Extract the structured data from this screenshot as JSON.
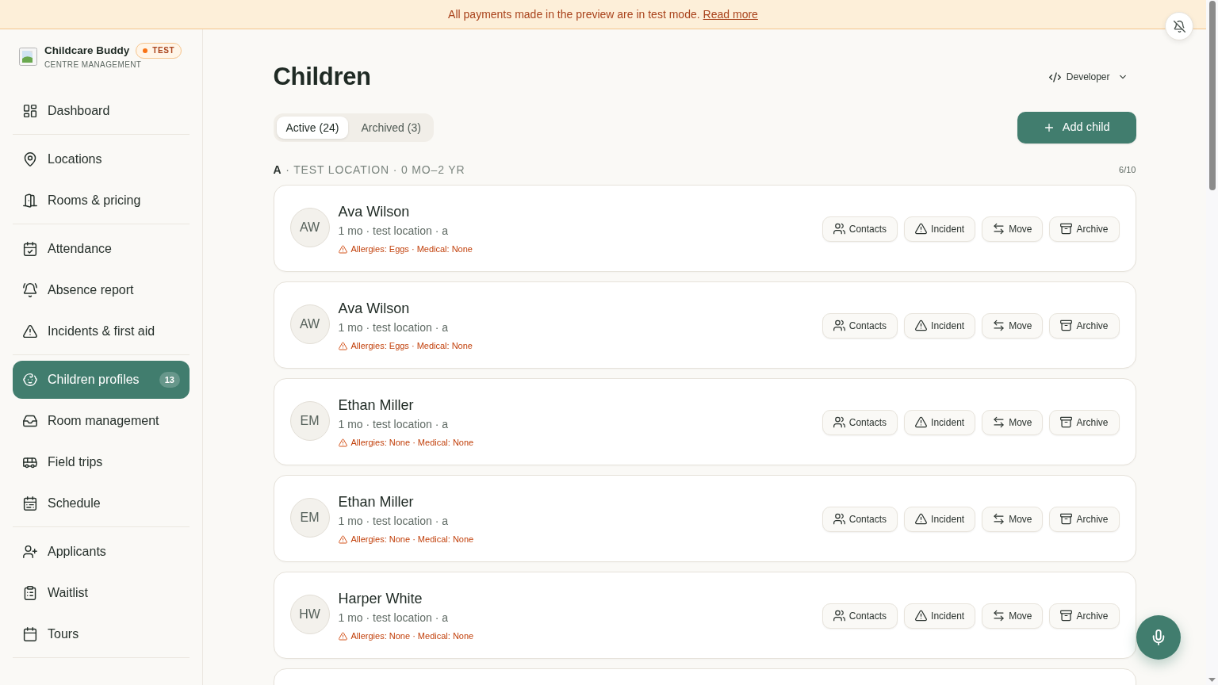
{
  "banner": {
    "message": "All payments made in the preview are in test mode.",
    "link": "Read more"
  },
  "sidebar": {
    "brand": {
      "name": "Childcare Buddy",
      "badge": "TEST",
      "subtitle": "CENTRE MANAGEMENT"
    },
    "groups": [
      {
        "items": [
          {
            "kind": "dashboard",
            "label": "Dashboard",
            "selected": false
          }
        ]
      },
      {
        "items": [
          {
            "kind": "locations",
            "label": "Locations",
            "selected": false
          },
          {
            "kind": "rooms",
            "label": "Rooms & pricing",
            "selected": false
          }
        ]
      },
      {
        "items": [
          {
            "kind": "attendance",
            "label": "Attendance",
            "selected": false
          },
          {
            "kind": "absence",
            "label": "Absence report",
            "selected": false
          },
          {
            "kind": "incidents",
            "label": "Incidents & first aid",
            "selected": false
          }
        ]
      },
      {
        "items": [
          {
            "kind": "children",
            "label": "Children profiles",
            "selected": true,
            "badge": "13"
          },
          {
            "kind": "room_management",
            "label": "Room management",
            "selected": false
          },
          {
            "kind": "field_trips",
            "label": "Field trips",
            "selected": false
          },
          {
            "kind": "schedule",
            "label": "Schedule",
            "selected": false
          }
        ]
      },
      {
        "items": [
          {
            "kind": "applicants",
            "label": "Applicants",
            "selected": false
          },
          {
            "kind": "waitlist",
            "label": "Waitlist",
            "selected": false
          },
          {
            "kind": "tours",
            "label": "Tours",
            "selected": false
          }
        ]
      }
    ]
  },
  "page": {
    "title": "Children",
    "view_menu": "Developer",
    "tabs": [
      {
        "label": "Active (24)",
        "selected": true
      },
      {
        "label": "Archived (3)",
        "selected": false
      }
    ],
    "add_button": "Add child"
  },
  "section": {
    "heading": "**A** · TEST LOCATION · 0 MO–2 YR",
    "capacity": "6/10"
  },
  "children": [
    {
      "initials": "AW",
      "name": "Ava Wilson",
      "details": "1 mo · test location · a",
      "health": "Allergies: Eggs · Medical: None",
      "actions": [
        {
          "kind": "contacts",
          "label": "Contacts"
        },
        {
          "kind": "incident",
          "label": "Incident"
        },
        {
          "kind": "move",
          "label": "Move"
        },
        {
          "kind": "archive",
          "label": "Archive"
        }
      ]
    },
    {
      "initials": "AW",
      "name": "Ava Wilson",
      "details": "1 mo · test location · a",
      "health": "Allergies: Eggs · Medical: None",
      "actions": [
        {
          "kind": "contacts",
          "label": "Contacts"
        },
        {
          "kind": "incident",
          "label": "Incident"
        },
        {
          "kind": "move",
          "label": "Move"
        },
        {
          "kind": "archive",
          "label": "Archive"
        }
      ]
    },
    {
      "initials": "EM",
      "name": "Ethan Miller",
      "details": "1 mo · test location · a",
      "health": "Allergies: None · Medical: None",
      "actions": [
        {
          "kind": "contacts",
          "label": "Contacts"
        },
        {
          "kind": "incident",
          "label": "Incident"
        },
        {
          "kind": "move",
          "label": "Move"
        },
        {
          "kind": "archive",
          "label": "Archive"
        }
      ]
    },
    {
      "initials": "EM",
      "name": "Ethan Miller",
      "details": "1 mo · test location · a",
      "health": "Allergies: None · Medical: None",
      "actions": [
        {
          "kind": "contacts",
          "label": "Contacts"
        },
        {
          "kind": "incident",
          "label": "Incident"
        },
        {
          "kind": "move",
          "label": "Move"
        },
        {
          "kind": "archive",
          "label": "Archive"
        }
      ]
    },
    {
      "initials": "HW",
      "name": "Harper White",
      "details": "1 mo · test location · a",
      "health": "Allergies: None · Medical: None",
      "actions": [
        {
          "kind": "contacts",
          "label": "Contacts"
        },
        {
          "kind": "incident",
          "label": "Incident"
        },
        {
          "kind": "move",
          "label": "Move"
        },
        {
          "kind": "archive",
          "label": "Archive"
        }
      ]
    }
  ]
}
